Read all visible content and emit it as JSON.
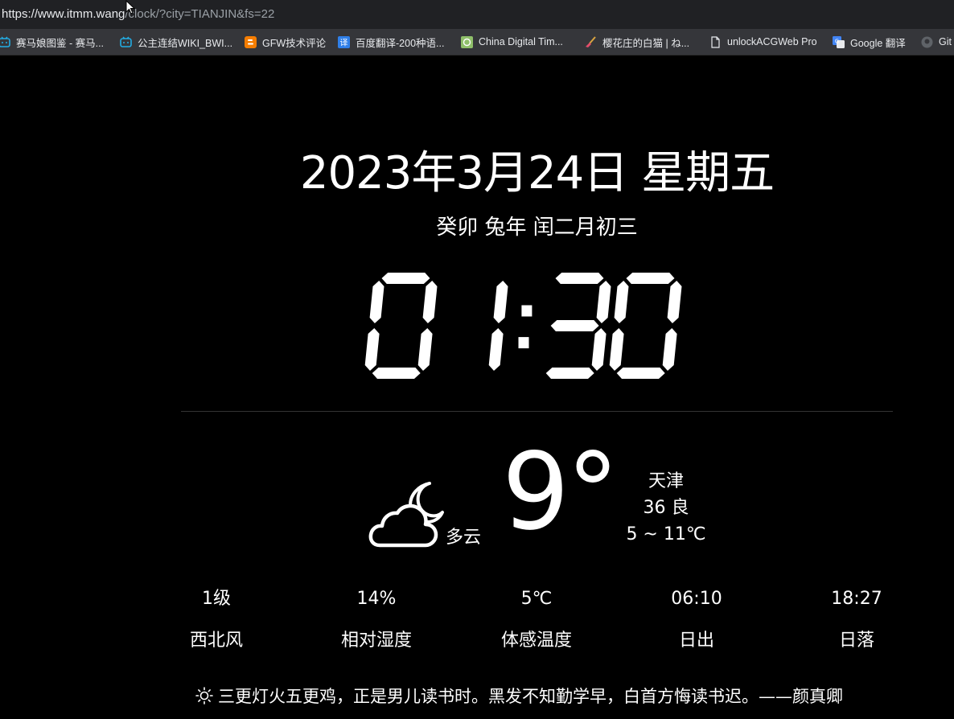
{
  "browser": {
    "url_host": "https://www.itmm.wang",
    "url_path": "/clock/?city=TIANJIN&fs=22",
    "bookmarks": [
      {
        "label": "赛马娘图鉴 - 赛马...",
        "icon": "bilibili-icon"
      },
      {
        "label": "公主连结WIKI_BWI...",
        "icon": "bilibili-icon"
      },
      {
        "label": "GFW技术评论",
        "icon": "blogger-icon"
      },
      {
        "label": "百度翻译-200种语...",
        "icon": "baidu-translate-icon"
      },
      {
        "label": "China Digital Tim...",
        "icon": "cdt-icon"
      },
      {
        "label": "樱花庄的白猫 | ね...",
        "icon": "broom-icon"
      },
      {
        "label": "unlockACGWeb Pro",
        "icon": "page-icon"
      },
      {
        "label": "Google 翻译",
        "icon": "google-translate-icon"
      },
      {
        "label": "Git",
        "icon": "github-icon"
      }
    ]
  },
  "clock": {
    "date": "2023年3月24日 星期五",
    "lunar": "癸卯 兔年 闰二月初三",
    "time": "01:30"
  },
  "weather": {
    "icon": "cloudy-night-icon",
    "condition": "多云",
    "temperature": "9°",
    "city": "天津",
    "aqi": "36 良",
    "range": "5 ~ 11℃"
  },
  "stats": [
    {
      "value": "1级",
      "label": "西北风"
    },
    {
      "value": "14%",
      "label": "相对湿度"
    },
    {
      "value": "5℃",
      "label": "体感温度"
    },
    {
      "value": "06:10",
      "label": "日出"
    },
    {
      "value": "18:27",
      "label": "日落"
    }
  ],
  "quote": {
    "icon": "sun-icon",
    "text": "三更灯火五更鸡，正是男儿读书时。黑发不知勤学早，白首方悔读书迟。——颜真卿"
  }
}
